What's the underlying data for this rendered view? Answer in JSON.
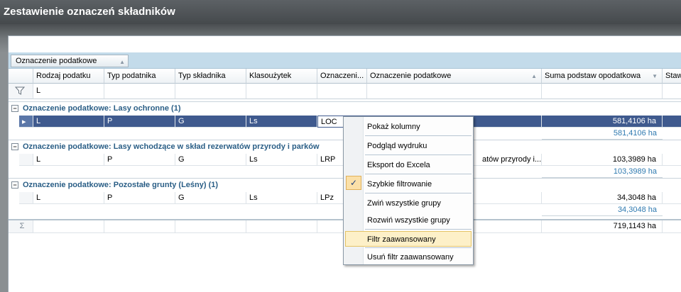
{
  "window": {
    "title": "Zestawienie oznaczeń składników"
  },
  "group_panel": {
    "tag": "Oznaczenie podatkowe"
  },
  "columns": [
    "Rodzaj podatku",
    "Typ podatnika",
    "Typ składnika",
    "Klasoużytek",
    "Oznaczeni...",
    "Oznaczenie podatkowe",
    "Suma podstaw opodatkowa",
    "Staw"
  ],
  "filter": {
    "rodzaj": "L"
  },
  "groups": [
    {
      "label": "Oznaczenie podatkowe:  Lasy ochronne   (1)",
      "row": {
        "rodzaj": "L",
        "typ_podatnika": "P",
        "typ_skladnika": "G",
        "klasouzytek": "Ls",
        "oznaczenie": "LOC",
        "oznaczenie_podatkowe": "",
        "suma": "581,4106 ha"
      },
      "subtotal": "581,4106 ha"
    },
    {
      "label": "Oznaczenie podatkowe:  Lasy wchodzące w skład rezerwatów przyrody i parków",
      "row": {
        "rodzaj": "L",
        "typ_podatnika": "P",
        "typ_skladnika": "G",
        "klasouzytek": "Ls",
        "oznaczenie": "LRP",
        "oznaczenie_podatkowe": "atów przyrody i...",
        "suma": "103,3989 ha"
      },
      "subtotal": "103,3989 ha"
    },
    {
      "label": "Oznaczenie podatkowe:  Pozostałe grunty (Leśny)  (1)",
      "row": {
        "rodzaj": "L",
        "typ_podatnika": "P",
        "typ_skladnika": "G",
        "klasouzytek": "Ls",
        "oznaczenie": "LPz",
        "oznaczenie_podatkowe": "",
        "suma": "34,3048 ha"
      },
      "subtotal": "34,3048 ha"
    }
  ],
  "total": {
    "symbol": "Σ",
    "value": "719,1143 ha"
  },
  "context_menu": {
    "items": [
      "Pokaż kolumny",
      "Podgląd wydruku",
      "Eksport do Excela",
      "Szybkie filtrowanie",
      "Zwiń wszystkie grupy",
      "Rozwiń wszystkie grupy",
      "Filtr zaawansowany",
      "Usuń filtr zaawansowany"
    ],
    "checked": "Szybkie filtrowanie",
    "highlighted": "Filtr zaawansowany"
  },
  "colors": {
    "group_text": "#2a5e86",
    "selected_row": "#3f5a8e",
    "subtotal_text": "#2f7ab0",
    "menu_highlight": "#fdf0c8"
  }
}
